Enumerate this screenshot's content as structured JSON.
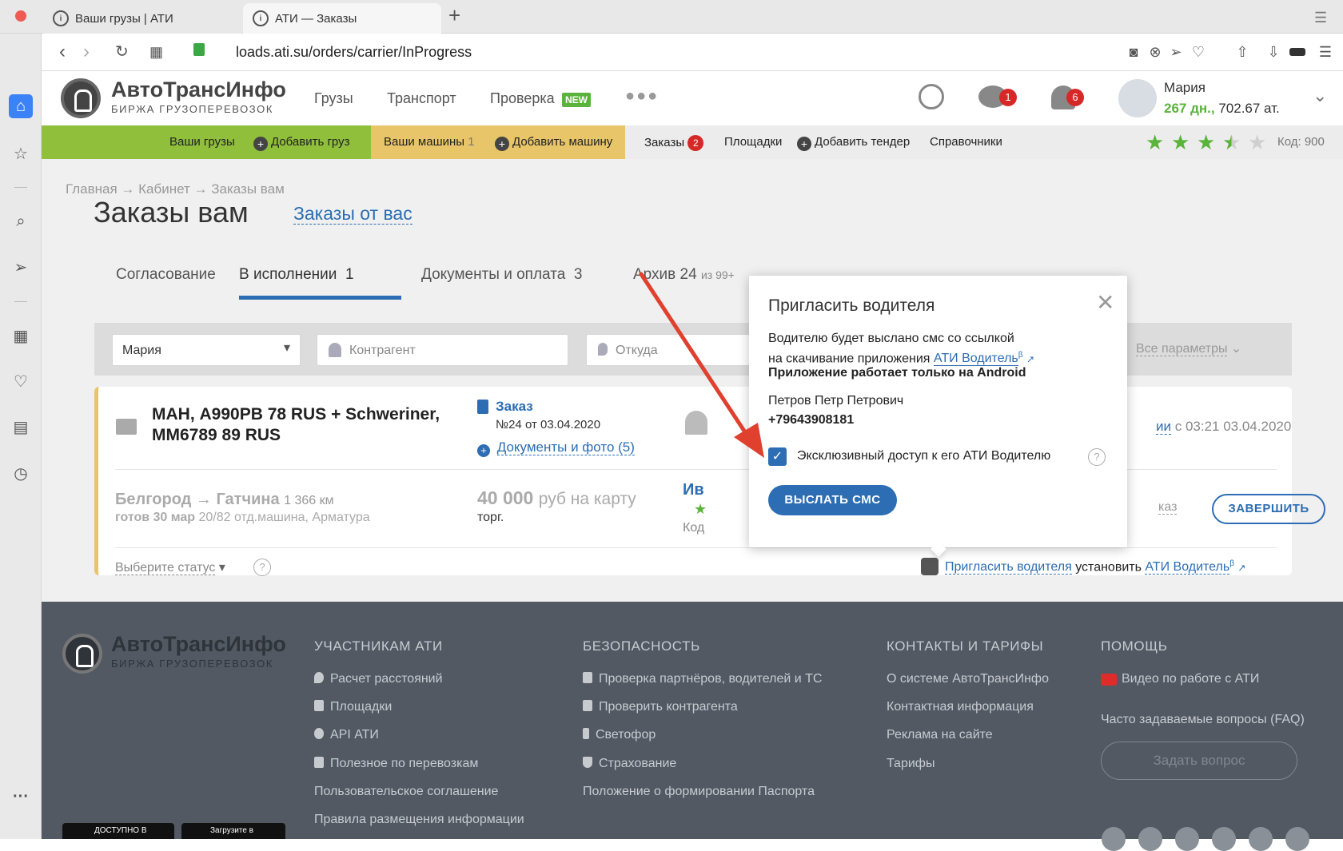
{
  "browser": {
    "tabs": [
      {
        "title": "Ваши грузы | АТИ"
      },
      {
        "title": "АТИ — Заказы"
      }
    ],
    "url": "loads.ati.su/orders/carrier/InProgress"
  },
  "header": {
    "logo_title": "АвтоТрансИнфо",
    "logo_subtitle": "БИРЖА ГРУЗОПЕРЕВОЗОК",
    "nav": [
      "Грузы",
      "Транспорт",
      "Проверка"
    ],
    "new_badge": "NEW",
    "messages_count": "1",
    "notifications_count": "6",
    "user_name": "Мария",
    "user_days": "267 дн.,",
    "user_balance": "702.67 ат."
  },
  "strip": {
    "loads": "Ваши грузы",
    "add_load": "Добавить груз",
    "vehicles": "Ваши машины",
    "vehicles_count": "1",
    "add_vehicle": "Добавить машину",
    "orders": "Заказы",
    "orders_count": "2",
    "platforms": "Площадки",
    "add_tender": "Добавить тендер",
    "references": "Справочники",
    "code": "Код: 900",
    "rating": 3.5,
    "green": "#8fbf3b",
    "yellow": "#e9c56a"
  },
  "main": {
    "breadcrumb": "Главная → Кабинет → Заказы вам",
    "title": "Заказы вам",
    "alt_title": "Заказы от вас",
    "tabs": [
      {
        "label": "Согласование",
        "count": ""
      },
      {
        "label": "В исполнении",
        "count": "1"
      },
      {
        "label": "Документы и оплата",
        "count": "3"
      },
      {
        "label": "Архив",
        "count": "24"
      }
    ],
    "archive_extra": "из 99+",
    "filters": {
      "user": "Мария",
      "contractor_placeholder": "Контрагент",
      "from_placeholder": "Откуда",
      "all_params": "Все параметры"
    },
    "order": {
      "vehicle": "МАН, А990РВ 78 RUS + Schweriner, ММ6789 89 RUS",
      "order_label": "Заказ",
      "order_number": "№24 от 03.04.2020",
      "docs": "Документы и фото (5)",
      "route_from": "Белгород",
      "route_to": "Гатчина",
      "distance": "1 366 км",
      "ready": "готов 30 мар",
      "cargo": "20/82 отд.машина, Арматура",
      "price": "40 000",
      "price_unit": "руб на карту",
      "bargain": "торг.",
      "contact_partial": "Ив",
      "code_partial": "Код",
      "status_partial": "ии",
      "since": "с 03:21 03.04.2020",
      "order_partial": "каз",
      "finish_button": "ЗАВЕРШИТЬ",
      "status_select": "Выберите статус",
      "invite_driver": "Пригласить водителя",
      "install": "установить",
      "ati_driver": "АТИ Водитель",
      "beta": "β"
    }
  },
  "popup": {
    "title": "Пригласить водителя",
    "text1": "Водителю будет выслано смс со ссылкой",
    "text2": "на скачивание приложения",
    "app_link": "АТИ Водитель",
    "beta": "β",
    "android_note": "Приложение работает только на Android",
    "driver_name": "Петров Петр Петрович",
    "driver_phone": "+79643908181",
    "exclusive_label": "Эксклюзивный доступ к его АТИ Водителю",
    "exclusive_checked": true,
    "send_button": "ВЫСЛАТЬ СМС"
  },
  "footer": {
    "logo_title": "АвтоТрансИнфо",
    "logo_subtitle": "БИРЖА ГРУЗОПЕРЕВОЗОК",
    "col1_title": "УЧАСТНИКАМ АТИ",
    "col1": [
      "Расчет расстояний",
      "Площадки",
      "API АТИ",
      "Полезное по перевозкам",
      "Пользовательское соглашение",
      "Правила размещения информации"
    ],
    "col2_title": "БЕЗОПАСНОСТЬ",
    "col2": [
      "Проверка партнёров, водителей и ТС",
      "Проверить контрагента",
      "Светофор",
      "Страхование",
      "Положение о формировании Паспорта"
    ],
    "col3_title": "КОНТАКТЫ И ТАРИФЫ",
    "col3": [
      "О системе АвтоТрансИнфо",
      "Контактная информация",
      "Реклама на сайте",
      "Тарифы"
    ],
    "col4_title": "ПОМОЩЬ",
    "video": "Видео по работе с АТИ",
    "faq": "Часто задаваемые вопросы (FAQ)",
    "ask_button": "Задать вопрос",
    "gplay": "ДОСТУПНО В",
    "appstore": "Загрузите в"
  }
}
